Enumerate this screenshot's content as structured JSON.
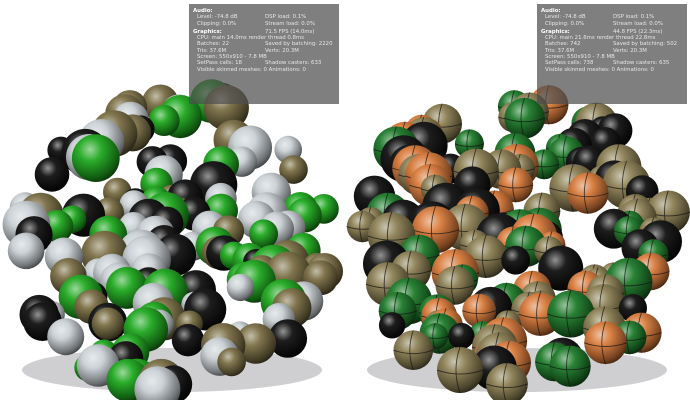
{
  "panels": [
    {
      "id": "left",
      "stats": {
        "audio_title": "Audio:",
        "level": "Level: -74.8 dB",
        "dsp_load": "DSP load: 0.1%",
        "clipping": "Clipping: 0.0%",
        "stream_load": "Stream load: 0.0%",
        "graphics_title": "Graphics:",
        "fps": "71.5 FPS (14.0ms)",
        "cpu": "CPU: main 14.0ms  render thread 0.8ms",
        "batches": "Batches: 22",
        "saved_batching": "Saved by batching: 2220",
        "tris": "Tris: 37.6M",
        "verts": "Verts: 20.3M",
        "screen": "Screen: 550x910 - 7.8 MB",
        "setpass": "SetPass calls: 18",
        "shadow_casters": "Shadow casters: 633",
        "skinned": "Visible skinned meshes: 0  Animations: 0"
      }
    },
    {
      "id": "right",
      "stats": {
        "audio_title": "Audio:",
        "level": "Level: -74.8 dB",
        "dsp_load": "DSP load: 0.1%",
        "clipping": "Clipping: 0.0%",
        "stream_load": "Stream load: 0.0%",
        "graphics_title": "Graphics:",
        "fps": "44.8 FPS (22.3ms)",
        "cpu": "CPU: main 21.6ms  render thread 22.8ms",
        "batches": "Batches: 742",
        "saved_batching": "Saved by batching: 502",
        "tris": "Tris: 37.6M",
        "verts": "Verts: 20.3M",
        "screen": "Screen: 550x910 - 7.8 MB",
        "setpass": "SetPass calls: 738",
        "shadow_casters": "Shadow casters: 635",
        "skinned": "Visible skinned meshes: 0  Animations: 0"
      }
    }
  ],
  "palette": {
    "left_sphere_colors": [
      "#111111",
      "#c9d0d4",
      "#1fa81f",
      "#7a6e45"
    ],
    "right_sphere_colors": [
      "#111111",
      "#d8793a",
      "#1e7a2a",
      "#8a7d52"
    ],
    "ground_shadow": "#a8a8ad",
    "stats_background": "#4e4e4e"
  }
}
